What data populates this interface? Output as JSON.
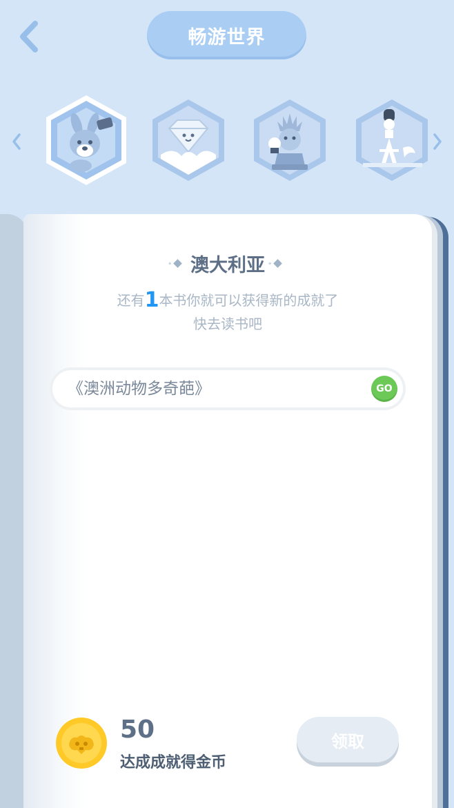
{
  "header": {
    "title": "畅游世界",
    "back_icon": "chevron-left-icon"
  },
  "carousel": {
    "prev_icon": "chevron-left-icon",
    "next_icon": "chevron-right-icon",
    "badges": [
      {
        "name": "kangaroo-badge",
        "selected": true
      },
      {
        "name": "diamond-badge",
        "selected": false
      },
      {
        "name": "statue-of-liberty-badge",
        "selected": false
      },
      {
        "name": "eiffel-tower-badge",
        "selected": false
      }
    ]
  },
  "page": {
    "country": "澳大利亚",
    "hint_prefix": "还有",
    "hint_count": "1",
    "hint_suffix": "本书你就可以获得新的成就了",
    "hint_line2": "快去读书吧",
    "book": {
      "title": "《澳洲动物多奇葩》",
      "go_label": "GO"
    },
    "reward": {
      "amount": "50",
      "label": "达成成就得金币",
      "claim_label": "领取",
      "icon": "gold-coin-icon"
    }
  },
  "colors": {
    "background": "#d4e5f8",
    "title_pill": "#a9cdf3",
    "go_button": "#6cc957",
    "highlight_number": "#2196f3",
    "coin": "#ffc928"
  }
}
